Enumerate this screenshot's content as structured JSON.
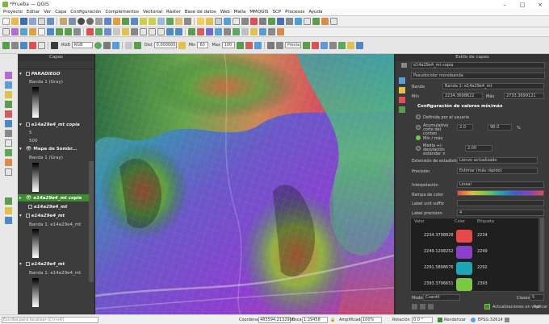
{
  "window": {
    "title": "*Prueba — QGIS"
  },
  "menu": [
    "Proyecto",
    "Editar",
    "Ver",
    "Capa",
    "Configuración",
    "Complementos",
    "Vectorial",
    "Ráster",
    "Base de datos",
    "Web",
    "Malla",
    "MMQGIS",
    "SCP",
    "Procesos",
    "Ayuda"
  ],
  "toolbar": {
    "rgb_label": "RGB",
    "band_dropdown": "RGB",
    "dist_label": "Dist",
    "dist_value": "0.000000",
    "min_label": "Min",
    "min_value": "60",
    "max_label": "Max",
    "max_value": "100",
    "preset_label": "Previa"
  },
  "layers": {
    "title": "Capas",
    "items": [
      {
        "label": "PARADIEGO",
        "kind": "group"
      },
      {
        "label": "Banda 1 (Gray)",
        "kind": "sub"
      },
      {
        "label": "e14a29e4_mt copia",
        "kind": "layer"
      },
      {
        "label": "500",
        "kind": "sub"
      },
      {
        "label": "Mapa de Sombr...",
        "kind": "layer"
      },
      {
        "label": "Banda 1 (Gray)",
        "kind": "sub"
      },
      {
        "label": "e14a29e4_mt copia",
        "kind": "selected"
      },
      {
        "label": "e14a29e4_mt",
        "kind": "layer"
      },
      {
        "label": "e14a29e4_mt",
        "kind": "layer"
      },
      {
        "label": "Banda 1: e14a29e4_mt",
        "kind": "sub"
      },
      {
        "label": "e14a29e4_mt",
        "kind": "layer"
      },
      {
        "label": "Banda 1: e14a29e4_mt",
        "kind": "sub"
      }
    ],
    "small_value": "5"
  },
  "style": {
    "title": "Estilo de capas",
    "layer_select": "e14a29e4_mt copia",
    "renderer": "Pseudocolor monobanda",
    "band_label": "Banda",
    "band_value": "Banda 1: e14a29e4_mt",
    "min_label": "Mín",
    "min_value": "2234.3698622",
    "max_label": "Máx",
    "max_value": "2733.3699121",
    "minmax_header": "Configuración de valores mín/máx",
    "options": [
      {
        "label": "Definida por el usuario",
        "checked": false
      },
      {
        "label": "Acumulativo corte del conteo",
        "checked": false
      },
      {
        "label": "Mín / máx",
        "checked": true
      },
      {
        "label": "Media +/- desviación estándar ×",
        "checked": false
      }
    ],
    "cut_low": "2.0",
    "cut_high": "98.0",
    "cut_unit": "%",
    "std_value": "2.00",
    "stats_label": "Extensión de estadísticas",
    "stats_value": "Lienzo actualizado",
    "precision_label": "Precisión",
    "precision_value": "Estimar (más rápido)",
    "interp_label": "Interpolación",
    "interp_value": "Lineal",
    "ramp_label": "Rampa de color",
    "unit_label": "Label unit suffix",
    "precision2_label": "Label precision",
    "precision2_value": "4",
    "table_headers": [
      "Valor",
      "Color",
      "Etiqueta"
    ],
    "table_rows": [
      {
        "value": "2234.3798828",
        "color": "#e84848",
        "label": "2234"
      },
      {
        "value": "2249.1298252",
        "color": "#8a3fcf",
        "label": "2249"
      },
      {
        "value": "2291.5898676",
        "color": "#1fa6b5",
        "label": "2292"
      },
      {
        "value": "2393.3796651",
        "color": "#7ac943",
        "label": "2393"
      }
    ],
    "mode_label": "Modo",
    "mode_value": "Cuantil",
    "classes_label": "Clases",
    "classes_value": "5",
    "live_update": "Actualizaciones en vivo",
    "apply": "Aplicar"
  },
  "status": {
    "search_placeholder": "Escriba para localizar (Ctrl+K)",
    "coord_label": "Coordenada",
    "coord_value": "485594,2132990",
    "scale_label": "Escala",
    "scale_value": "1:29458",
    "magnifier_label": "Amplificador",
    "magnifier_value": "100%",
    "rotation_label": "Rotación",
    "rotation_value": "0.0 °",
    "render_label": "Renderizar",
    "crs_value": "EPSG:32614"
  }
}
